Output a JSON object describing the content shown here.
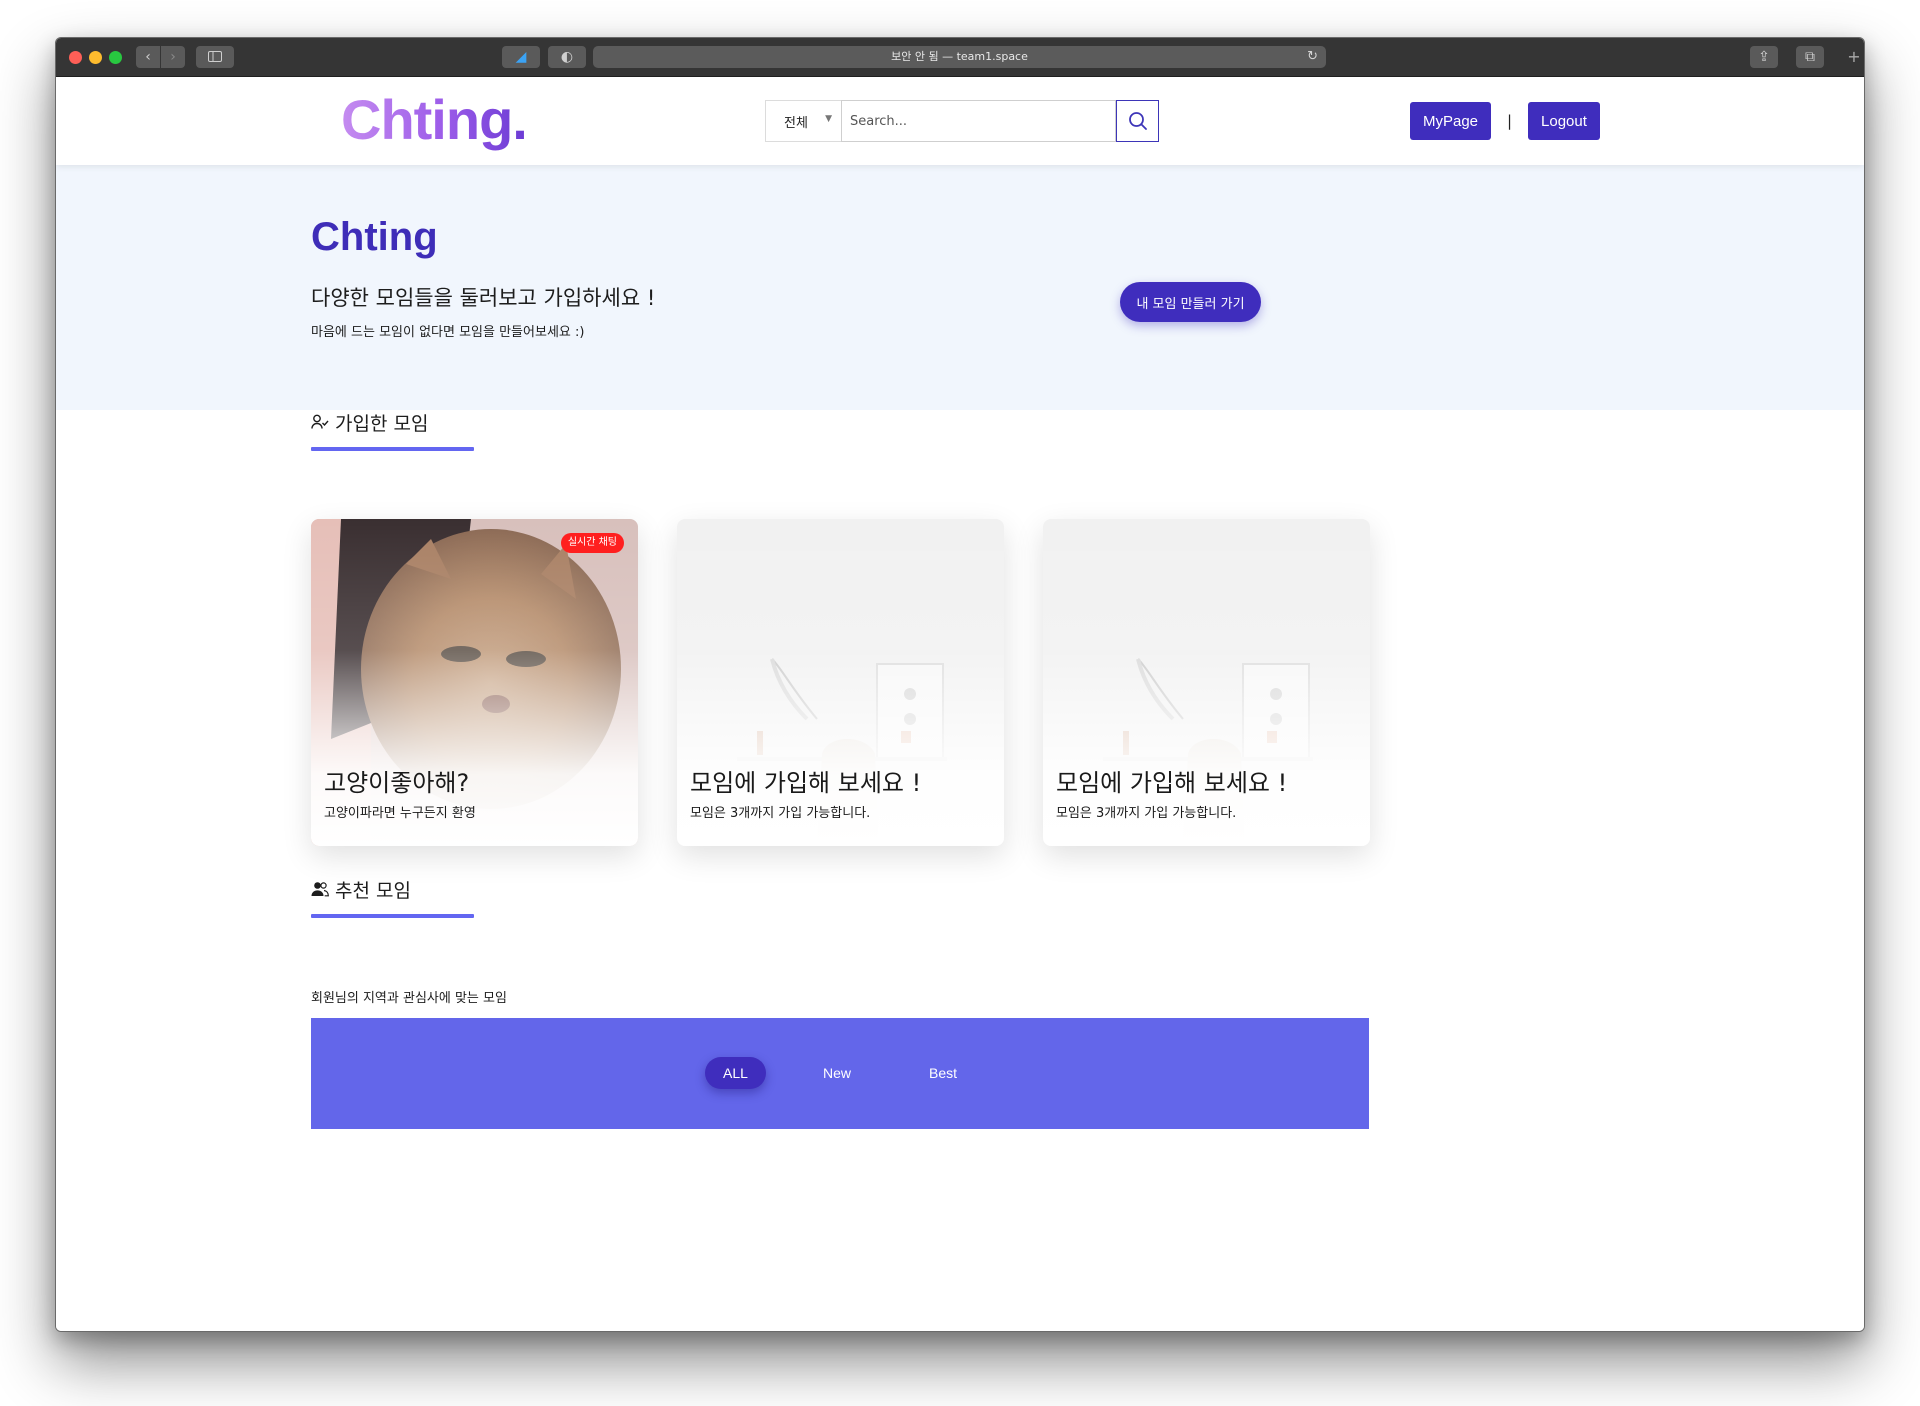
{
  "browser": {
    "url_text": "보안 안 됨 — team1.space"
  },
  "navbar": {
    "logo": "Chting.",
    "search_category": "전체",
    "search_placeholder": "Search...",
    "mypage_label": "MyPage",
    "separator": "|",
    "logout_label": "Logout"
  },
  "hero": {
    "title": "Chting",
    "subtitle": "다양한 모임들을 둘러보고 가입하세요 !",
    "note": "마음에 드는 모임이 없다면 모임을 만들어보세요 :)",
    "create_button": "내 모임 만들러 가기"
  },
  "joined_section": {
    "title": "가입한 모임",
    "cards": [
      {
        "title": "고양이좋아해?",
        "desc": "고양이파라면 누구든지 환영",
        "badge": "실시간 채팅",
        "image": "kitten-photo"
      },
      {
        "title": "모임에 가입해 보세요 !",
        "desc": "모임은 3개까지 가입 가능합니다.",
        "image": "desk-room-photo"
      },
      {
        "title": "모임에 가입해 보세요 !",
        "desc": "모임은 3개까지 가입 가능합니다.",
        "image": "desk-room-photo"
      }
    ]
  },
  "recommended_section": {
    "title": "추천 모임",
    "note": "회원님의 지역과 관심사에 맞는 모임",
    "filters": [
      "ALL",
      "New",
      "Best"
    ],
    "active_filter": "ALL"
  },
  "colors": {
    "brand": "#3f2dbd",
    "accent_bar": "#6366f1",
    "filter_bg": "#6366ea",
    "badge": "#ff1f1f",
    "hero_bg": "#f1f6fd"
  }
}
